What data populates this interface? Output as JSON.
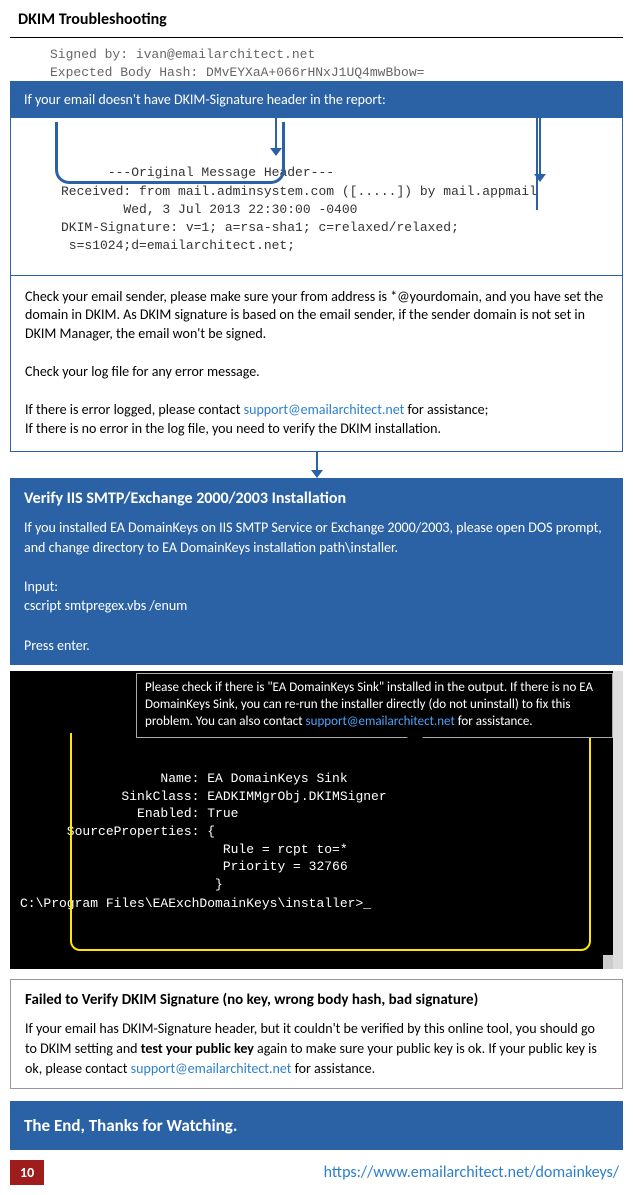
{
  "title": "DKIM Troubleshooting",
  "faded_code": "Signed by: ivan@emailarchitect.net\nExpected Body Hash: DMvEYXaA+066rHNxJ1UQ4mwBbow=\n",
  "banner1": "If your email doesn't have DKIM-Signature header in the report:",
  "code_snippet": "---Original Message Header---\nReceived: from mail.adminsystem.com ([.....]) by mail.appmail\n        Wed, 3 Jul 2013 22:30:00 -0400\nDKIM-Signature: v=1; a=rsa-sha1; c=relaxed/relaxed;\n s=s1024;d=emailarchitect.net;",
  "check_text_1": "Check your email sender, please make sure your from address is *@yourdomain, and you have set the domain in DKIM. As DKIM signature is based on the email sender, if the sender domain is not set in DKIM Manager, the email won't be signed.",
  "check_text_2": "Check your log file for any error message.",
  "check_text_3a": "If there is error logged, please contact ",
  "support_email": "support@emailarchitect.net",
  "check_text_3b": " for assistance;",
  "check_text_4": "If there is no error in the log file, you need to verify the DKIM installation.",
  "verify_heading": "Verify IIS SMTP/Exchange 2000/2003 Installation",
  "verify_text_1": "If you installed EA DomainKeys on IIS SMTP Service or Exchange 2000/2003, please open DOS prompt, and change directory to EA DomainKeys installation path\\installer.",
  "verify_input_label": "Input:",
  "verify_input_cmd": "cscript smtpregex.vbs /enum",
  "verify_press": "Press enter.",
  "tooltip_1": "Please check if there is \"EA DomainKeys Sink\" installed in the output. If there is no EA DomainKeys Sink, you can re-run the installer directly (do not uninstall) to fix this problem. You can also contact ",
  "tooltip_2": " for assistance.",
  "console_body": "                  Name: EA DomainKeys Sink\n             SinkClass: EADKIMMgrObj.DKIMSigner\n               Enabled: True\n      SourceProperties: {\n                          Rule = rcpt to=*\n                          Priority = 32766\n                         }",
  "console_prompt": "C:\\Program Files\\EAExchDomainKeys\\installer>_",
  "fail_heading": "Failed to Verify DKIM Signature (no key, wrong body hash, bad signature)",
  "fail_text_1": "If your email has DKIM-Signature header, but it couldn't be verified by this online tool, you should go to DKIM setting and ",
  "fail_bold": "test your public key",
  "fail_text_2": " again to make sure your public key is ok. If your public key is ok, please contact ",
  "fail_text_3": " for assistance.",
  "end_text": "The End, Thanks for Watching.",
  "page_num": "10",
  "footer_url": "https://www.emailarchitect.net/domainkeys/"
}
